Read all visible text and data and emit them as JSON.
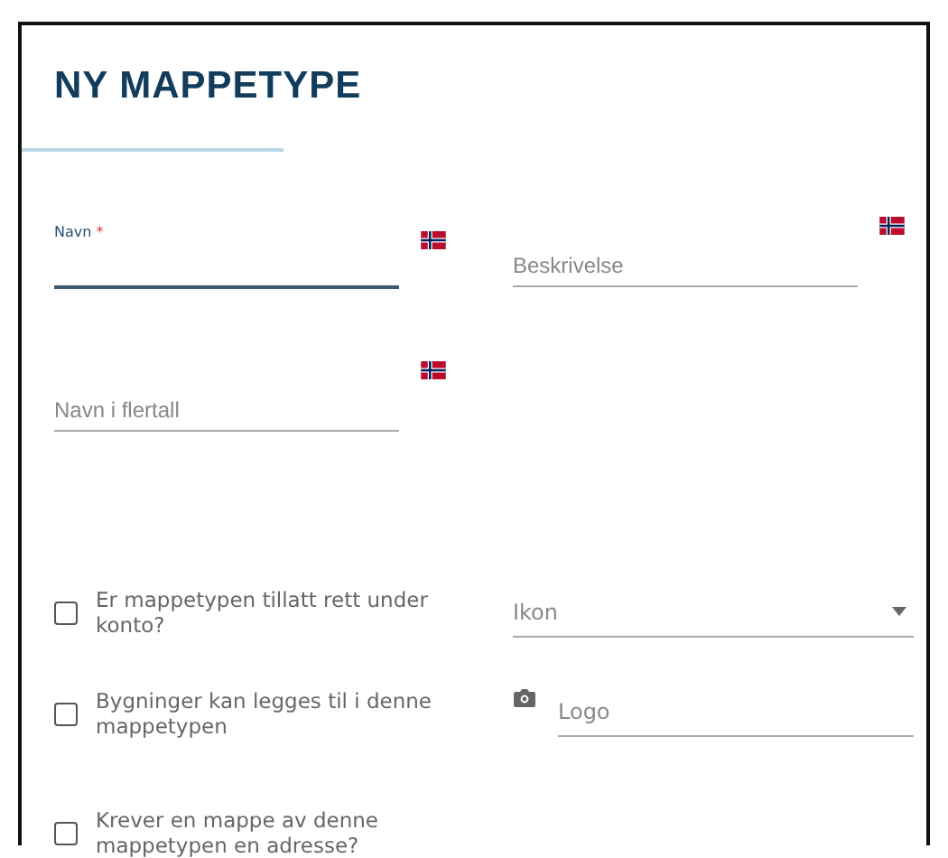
{
  "title": "NY MAPPETYPE",
  "text_fields": [
    {
      "label": "Navn",
      "required_mark": "*",
      "focused": true
    },
    {
      "placeholder": "Beskrivelse",
      "focused": false
    },
    {
      "placeholder": "Navn i flertall",
      "focused": false
    }
  ],
  "checkboxes": [
    {
      "label": "Er mappetypen tillatt rett under konto?",
      "checked": false
    },
    {
      "label": "Bygninger kan legges til i denne mappetypen",
      "checked": false
    },
    {
      "label": "Krever en mappe av denne mappetypen en adresse?",
      "checked": false
    }
  ],
  "icon_select": {
    "placeholder": "Ikon"
  },
  "logo_field": {
    "placeholder": "Logo"
  }
}
